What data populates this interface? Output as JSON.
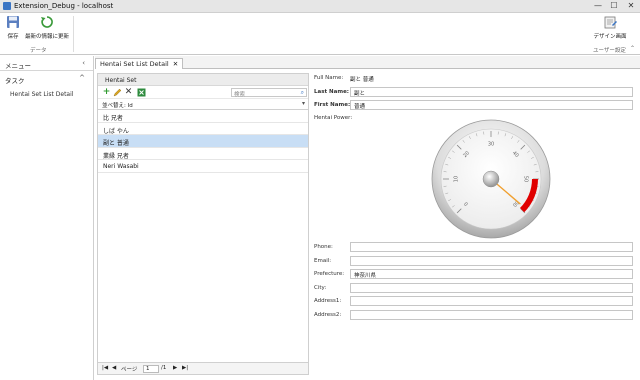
{
  "window": {
    "title": "Extension_Debug - localhost",
    "controls": [
      "—",
      "☐",
      "✕"
    ]
  },
  "ribbon": {
    "save_label": "保存",
    "refresh_label": "最新の情報に更新",
    "group_data": "データ",
    "design_label": "デザイン画面",
    "group_user": "ユーザー設定"
  },
  "sidebar": {
    "menu_label": "メニュー",
    "tasks_label": "タスク",
    "items": [
      {
        "label": "Hentai Set List Detail"
      }
    ]
  },
  "tab": {
    "label": "Hentai Set List Detail",
    "close": "✕"
  },
  "list": {
    "header": "Hentai Set",
    "search_placeholder": "検索",
    "sort_label": "並べ替え: Id",
    "rows": [
      {
        "label": "比 兄者"
      },
      {
        "label": "しば やん"
      },
      {
        "label": "副と 普通"
      },
      {
        "label": "業縁 兄者"
      },
      {
        "label": "Neri Wasabi"
      }
    ],
    "selected_index": 2,
    "pager": {
      "page_label": "ページ",
      "page_value": "1",
      "page_total": "/1",
      "first": "|◀",
      "prev": "◀",
      "next": "▶",
      "last": "▶|"
    }
  },
  "detail": {
    "full_name_label": "Full Name:",
    "full_name_value": "副と 普通",
    "last_name_label": "Last Name:",
    "last_name_value": "副と",
    "first_name_label": "First Name:",
    "first_name_value": "普通",
    "power_label": "Hentai Power:",
    "phone_label": "Phone:",
    "email_label": "Email:",
    "prefecture_label": "Prefecture:",
    "prefecture_value": "神奈川県",
    "city_label": "City:",
    "address1_label": "Address1:",
    "address2_label": "Address2:"
  },
  "gauge": {
    "min": 0,
    "max": 60,
    "ticks": [
      "0",
      "10",
      "20",
      "30",
      "40",
      "50",
      "60"
    ],
    "needle_value": 59,
    "red_range": [
      50,
      60
    ],
    "red_color": "#e00000",
    "needle_color": "#f0a030"
  }
}
